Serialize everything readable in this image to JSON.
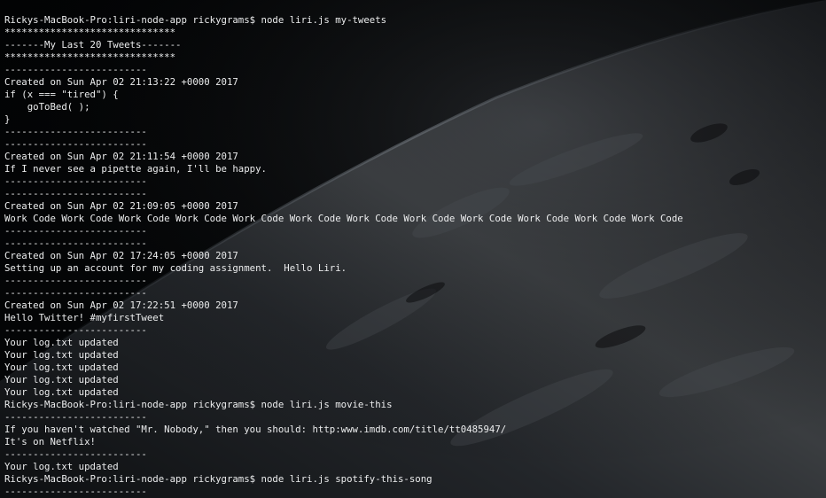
{
  "terminal": {
    "lines": [
      "Rickys-MacBook-Pro:liri-node-app rickygrams$ node liri.js my-tweets",
      "******************************",
      "-------My Last 20 Tweets-------",
      "******************************",
      "-------------------------",
      "Created on Sun Apr 02 21:13:22 +0000 2017",
      "if (x === \"tired\") {",
      "    goToBed( );",
      "}",
      "-------------------------",
      "-------------------------",
      "Created on Sun Apr 02 21:11:54 +0000 2017",
      "If I never see a pipette again, I'll be happy.",
      "-------------------------",
      "-------------------------",
      "Created on Sun Apr 02 21:09:05 +0000 2017",
      "Work Code Work Code Work Code Work Code Work Code Work Code Work Code Work Code Work Code Work Code Work Code Work Code",
      "-------------------------",
      "-------------------------",
      "Created on Sun Apr 02 17:24:05 +0000 2017",
      "Setting up an account for my coding assignment.  Hello Liri.",
      "-------------------------",
      "-------------------------",
      "Created on Sun Apr 02 17:22:51 +0000 2017",
      "Hello Twitter! #myfirstTweet",
      "-------------------------",
      "Your log.txt updated",
      "Your log.txt updated",
      "Your log.txt updated",
      "Your log.txt updated",
      "Your log.txt updated",
      "Rickys-MacBook-Pro:liri-node-app rickygrams$ node liri.js movie-this",
      "-------------------------",
      "If you haven't watched \"Mr. Nobody,\" then you should: http:www.imdb.com/title/tt0485947/",
      "It's on Netflix!",
      "-------------------------",
      "Your log.txt updated",
      "Rickys-MacBook-Pro:liri-node-app rickygrams$ node liri.js spotify-this-song",
      "-------------------------"
    ]
  },
  "colors": {
    "text": "#ecedee",
    "background": "#050607",
    "planet_shadow": "#1a1c1e"
  }
}
